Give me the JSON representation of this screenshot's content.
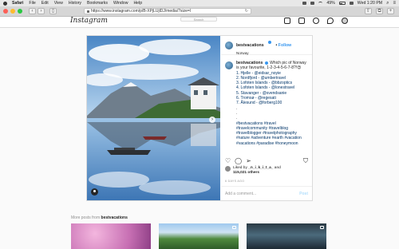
{
  "menubar": {
    "app": "Safari",
    "items": [
      "File",
      "Edit",
      "View",
      "History",
      "Bookmarks",
      "Window",
      "Help"
    ],
    "battery": "49%",
    "clock": "Wed 1:20 PM"
  },
  "browser": {
    "url": "https://www.instagram.com/p/B-XPjLUjlDJ/media/?size=l",
    "reload_icon": "reload-icon"
  },
  "instagram": {
    "logo": "Instagram",
    "search_placeholder": "Search"
  },
  "post": {
    "username": "bestvacations",
    "follow_label": "Follow",
    "location": "Norway",
    "caption_lines": [
      "Which pic of Norway",
      "is your favourite, 1-2-3-4-5-6-7-8?!😍",
      "1. Hjelle - @eidsar_noyie",
      "2. Nordfjord - @umbertravel",
      "3. Lofoten Islands - @bbzoptics",
      "4. Lofoten Islands - @lonestravel",
      "5. Stavanger - @svendsanie",
      "6. Tromsø - @regesati",
      "7. Ålesund - @forberg100"
    ],
    "dots": [
      ".",
      ".",
      "."
    ],
    "hashtags": [
      "#bestvacations #travel",
      "#travelcommunity #travelblog",
      "#travelblogger #travelphotography",
      "#nature #adventure #earth #vacation",
      "#vacations #paradise #honeymoon"
    ],
    "liked_by_label": "Liked by",
    "liked_by_user": "_n_i_k_i_t_a_",
    "liked_and": "and",
    "likes_count": "115,021 others",
    "posted_date": "6 DAYS AGO",
    "comment_placeholder": "Add a comment...",
    "post_button": "Post"
  },
  "more_posts": {
    "label": "More posts from",
    "username": "bestvacations"
  },
  "colors": {
    "accent": "#3897f0",
    "link": "#003569",
    "border": "#dbdbdb"
  }
}
